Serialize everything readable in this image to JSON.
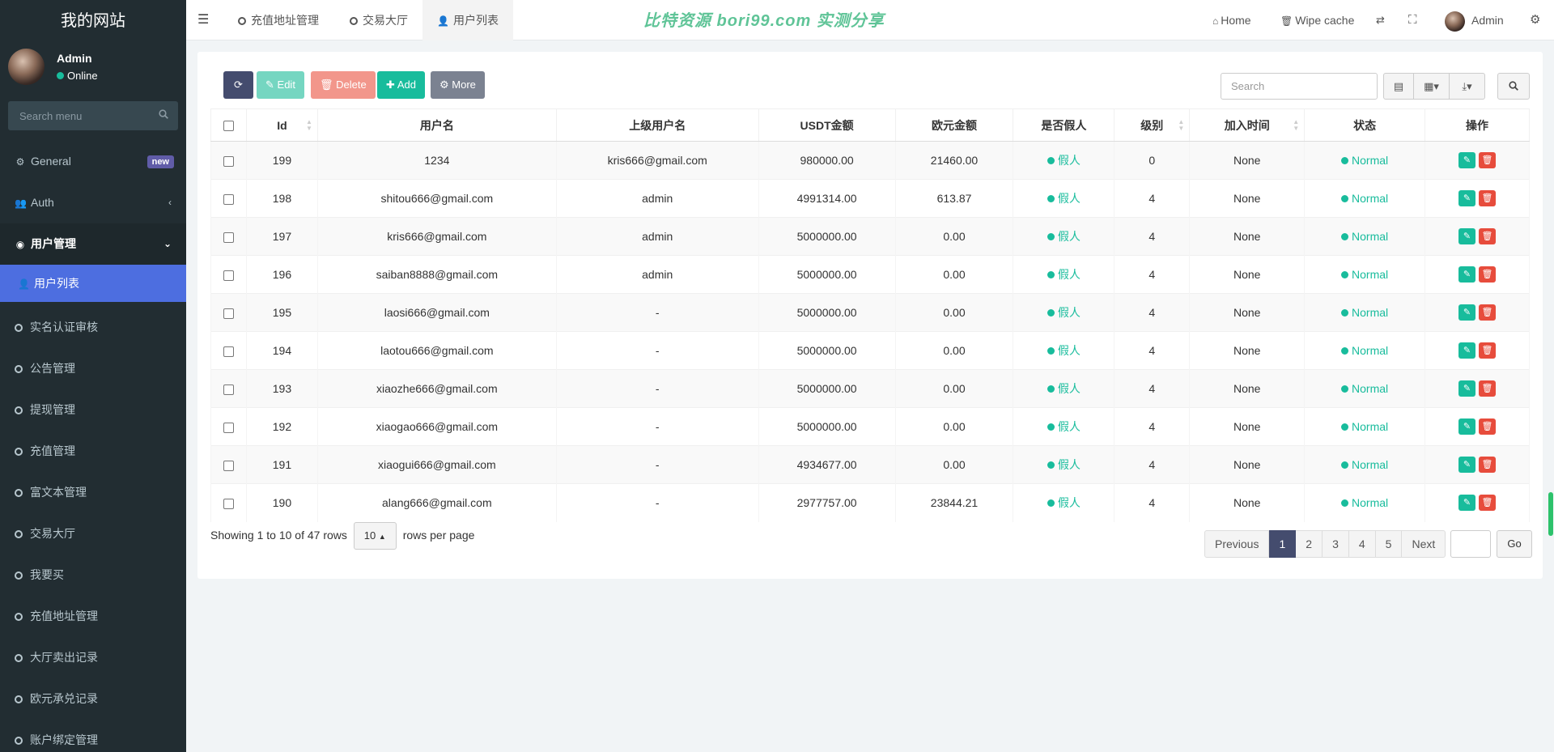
{
  "sidebar": {
    "logo": "我的网站",
    "user_name": "Admin",
    "user_status": "Online",
    "search_placeholder": "Search menu",
    "items": [
      {
        "label": "General",
        "icon": "cogs-icon",
        "badge": "new"
      },
      {
        "label": "Auth",
        "icon": "users-icon",
        "caret": "‹"
      },
      {
        "label": "用户管理",
        "icon": "user-circle-icon",
        "caret": "⌄"
      },
      {
        "label": "用户列表",
        "icon": "user-icon",
        "active": true
      },
      {
        "label": "实名认证审核"
      },
      {
        "label": "公告管理"
      },
      {
        "label": "提现管理"
      },
      {
        "label": "充值管理"
      },
      {
        "label": "富文本管理"
      },
      {
        "label": "交易大厅"
      },
      {
        "label": "我要买"
      },
      {
        "label": "充值地址管理"
      },
      {
        "label": "大厅卖出记录"
      },
      {
        "label": "欧元承兑记录"
      },
      {
        "label": "账户绑定管理"
      }
    ]
  },
  "topbar": {
    "tabs": [
      {
        "label": "充值地址管理"
      },
      {
        "label": "交易大厅"
      },
      {
        "label": "用户列表",
        "active": true
      }
    ],
    "watermark": "比特资源 bori99.com 实测分享",
    "home": "Home",
    "wipe_cache": "Wipe cache",
    "admin": "Admin"
  },
  "toolbar": {
    "edit": "Edit",
    "delete": "Delete",
    "add": "Add",
    "more": "More",
    "search_placeholder": "Search"
  },
  "table": {
    "headers": [
      "Id",
      "用户名",
      "上级用户名",
      "USDT金额",
      "欧元金额",
      "是否假人",
      "级别",
      "加入时间",
      "状态",
      "操作"
    ],
    "rows": [
      [
        "199",
        "1234",
        "kris666@gmail.com",
        "980000.00",
        "21460.00",
        "假人",
        "0",
        "None",
        "Normal"
      ],
      [
        "198",
        "shitou666@gmail.com",
        "admin",
        "4991314.00",
        "613.87",
        "假人",
        "4",
        "None",
        "Normal"
      ],
      [
        "197",
        "kris666@gmail.com",
        "admin",
        "5000000.00",
        "0.00",
        "假人",
        "4",
        "None",
        "Normal"
      ],
      [
        "196",
        "saiban8888@gmail.com",
        "admin",
        "5000000.00",
        "0.00",
        "假人",
        "4",
        "None",
        "Normal"
      ],
      [
        "195",
        "laosi666@gmail.com",
        "-",
        "5000000.00",
        "0.00",
        "假人",
        "4",
        "None",
        "Normal"
      ],
      [
        "194",
        "laotou666@gmail.com",
        "-",
        "5000000.00",
        "0.00",
        "假人",
        "4",
        "None",
        "Normal"
      ],
      [
        "193",
        "xiaozhe666@gmail.com",
        "-",
        "5000000.00",
        "0.00",
        "假人",
        "4",
        "None",
        "Normal"
      ],
      [
        "192",
        "xiaogao666@gmail.com",
        "-",
        "5000000.00",
        "0.00",
        "假人",
        "4",
        "None",
        "Normal"
      ],
      [
        "191",
        "xiaogui666@gmail.com",
        "-",
        "4934677.00",
        "0.00",
        "假人",
        "4",
        "None",
        "Normal"
      ],
      [
        "190",
        "alang666@gmail.com",
        "-",
        "2977757.00",
        "23844.21",
        "假人",
        "4",
        "None",
        "Normal"
      ]
    ]
  },
  "pagination": {
    "showing": "Showing 1 to 10 of 47 rows",
    "per_page": "10",
    "rows_per_page": "rows per page",
    "previous": "Previous",
    "pages": [
      "1",
      "2",
      "3",
      "4",
      "5"
    ],
    "current": "1",
    "next": "Next",
    "go": "Go"
  },
  "colors": {
    "sidebar_bg": "#222d32",
    "active_item": "#4d6ee0",
    "green": "#18bc9c",
    "red": "#e74c3c",
    "primary_dark": "#444c6e"
  }
}
